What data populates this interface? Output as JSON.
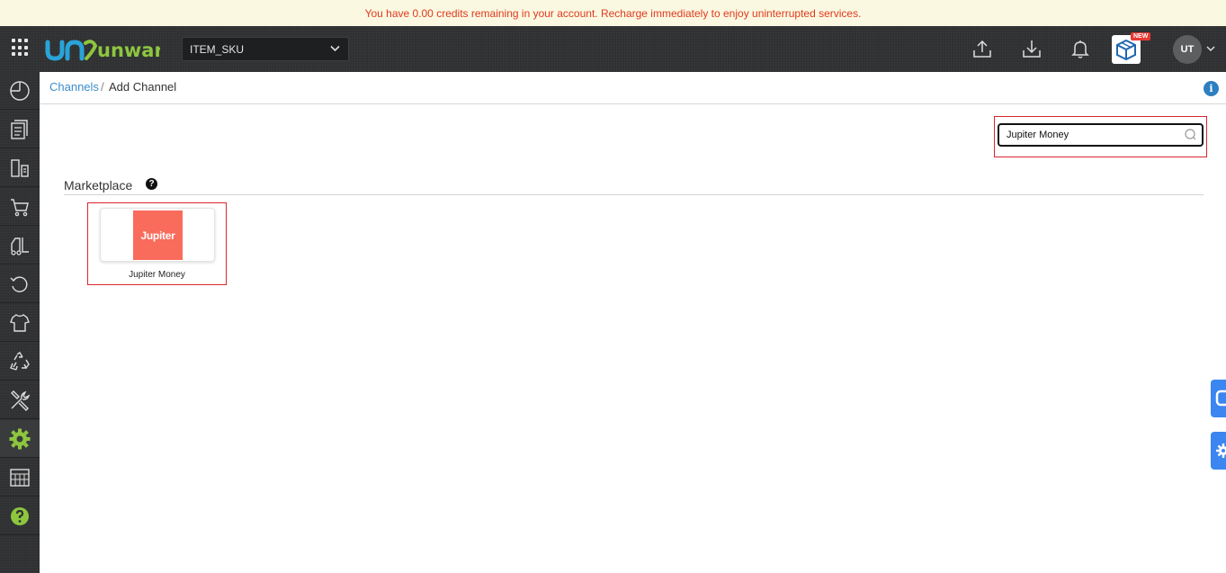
{
  "banner": {
    "text": "You have 0.00 credits remaining in your account. Recharge immediately to enjoy uninterrupted services."
  },
  "header": {
    "logo_text": "unware",
    "sku_select": {
      "value": "ITEM_SKU"
    },
    "new_badge": "NEW",
    "avatar_initials": "UT",
    "icons": [
      "apps-grid-icon",
      "upload-icon",
      "download-icon",
      "bell-icon",
      "cube-icon",
      "chevron-down-icon"
    ]
  },
  "sidebar": {
    "items": [
      {
        "icon": "dashboard-icon"
      },
      {
        "icon": "orders-icon"
      },
      {
        "icon": "shipping-icon"
      },
      {
        "icon": "cart-icon"
      },
      {
        "icon": "forklift-icon"
      },
      {
        "icon": "returns-icon"
      },
      {
        "icon": "product-icon"
      },
      {
        "icon": "recycle-icon"
      },
      {
        "icon": "tools-icon"
      },
      {
        "icon": "settings-icon",
        "active": true
      },
      {
        "icon": "reports-icon"
      },
      {
        "icon": "help-icon"
      }
    ]
  },
  "breadcrumb": {
    "parent": "Channels",
    "separator": "/",
    "current": "Add Channel"
  },
  "search": {
    "value": "Jupiter Money",
    "placeholder": ""
  },
  "section": {
    "title": "Marketplace"
  },
  "channels": [
    {
      "name": "Jupiter Money",
      "logo_text": "Jupiter",
      "logo_color": "#f96b5b"
    }
  ],
  "colors": {
    "accent_blue": "#3c8dcb",
    "banner_text": "#e03a1e",
    "highlight_red": "#d9262f",
    "logo_green": "#8dc63f",
    "logo_blue": "#2aa3d8"
  }
}
